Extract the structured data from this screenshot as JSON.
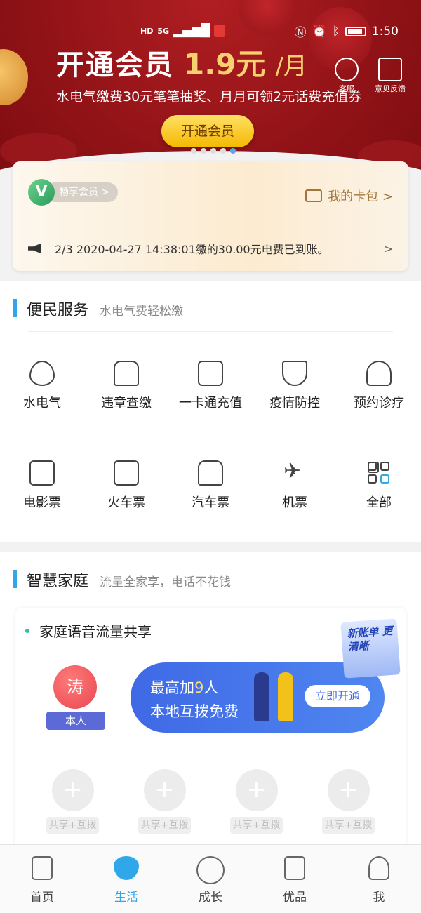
{
  "status_bar": {
    "network_left": "HD",
    "network_5g": "5G",
    "time": "1:50",
    "right_icons": [
      "nfc-icon",
      "alarm-icon",
      "bluetooth-icon",
      "battery-icon"
    ]
  },
  "banner": {
    "title": "开通会员",
    "price": "1.9元",
    "per": "/月",
    "subtitle": "水电气缴费30元笔笔抽奖、月月可领2元话费充值券",
    "cta": "开通会员",
    "carousel_total": 5,
    "carousel_active": 5,
    "service_label": "客服",
    "feedback_label": "意见反馈"
  },
  "member": {
    "badge_label": "畅享会员",
    "badge_arrow": ">",
    "wallet_label": "我的卡包 >",
    "notice_text": "2/3  2020-04-27 14:38:01缴的30.00元电费已到账。",
    "notice_arrow": ">"
  },
  "convenience": {
    "title": "便民服务",
    "subtitle": "水电气费轻松缴",
    "row1": [
      {
        "label": "水电气",
        "icon": "water-drop-icon"
      },
      {
        "label": "违章查缴",
        "icon": "car-search-icon"
      },
      {
        "label": "一卡通充值",
        "icon": "bus-card-icon"
      },
      {
        "label": "疫情防控",
        "icon": "shield-virus-icon"
      },
      {
        "label": "预约诊疗",
        "icon": "doctor-icon"
      }
    ],
    "row2": [
      {
        "label": "电影票",
        "icon": "ticket-icon"
      },
      {
        "label": "火车票",
        "icon": "train-icon"
      },
      {
        "label": "汽车票",
        "icon": "bus-icon"
      },
      {
        "label": "机票",
        "icon": "plane-icon"
      },
      {
        "label": "全部",
        "icon": "grid-icon"
      }
    ]
  },
  "smart_home": {
    "title": "智慧家庭",
    "subtitle": "流量全家享，电话不花钱",
    "card_title": "家庭语音流量共享",
    "avatar_char": "涛",
    "me_label": "本人",
    "promo_line1_prefix": "最高加",
    "promo_line1_num": "9",
    "promo_line1_suffix": "人",
    "promo_line2": "本地互拨免费",
    "promo_button": "立即开通",
    "ribbon_text": "新账单 更清晰",
    "slots": [
      {
        "plus": "+",
        "label": "共享+互拨"
      },
      {
        "plus": "+",
        "label": "共享+互拨"
      },
      {
        "plus": "+",
        "label": "共享+互拨"
      },
      {
        "plus": "+",
        "label": "共享+互拨"
      }
    ]
  },
  "tabbar": {
    "tabs": [
      {
        "label": "首页",
        "icon": "phone-icon",
        "active": false
      },
      {
        "label": "生活",
        "icon": "heart-home-icon",
        "active": true
      },
      {
        "label": "成长",
        "icon": "sprout-icon",
        "active": false
      },
      {
        "label": "优品",
        "icon": "shopping-bag-icon",
        "active": false
      },
      {
        "label": "我",
        "icon": "person-icon",
        "active": false
      }
    ],
    "active_color": "#2fa7e8"
  }
}
